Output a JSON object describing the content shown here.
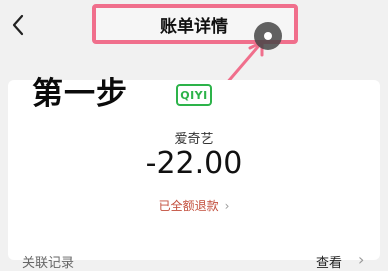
{
  "header": {
    "title": "账单详情",
    "back_icon": "chevron-left-icon"
  },
  "annotation": {
    "step": "第一步"
  },
  "bill": {
    "logo_text": "QIYI",
    "merchant": "爱奇艺",
    "amount": "-22.00",
    "refund_status": "已全额退款",
    "refund_chevron": "›"
  },
  "related": {
    "label": "关联记录",
    "view_label": "查看",
    "view_chevron": "›"
  },
  "colors": {
    "highlight": "#f06f8c",
    "refund": "#c24d3b",
    "logo": "#2db34a"
  }
}
